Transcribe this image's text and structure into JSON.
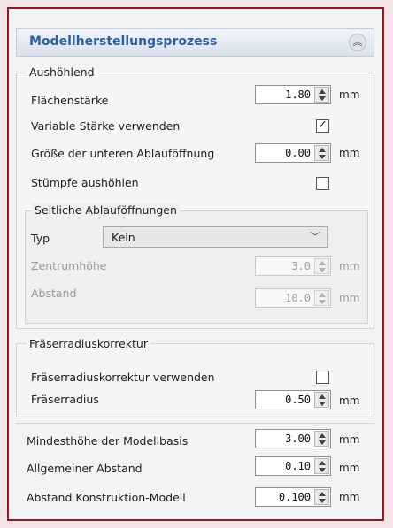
{
  "panel": {
    "title": "Modellherstellungsprozess",
    "collapse_icon": "double-chevron-up-icon"
  },
  "hollowing": {
    "group_title": "Aushöhlend",
    "wall_thickness": {
      "label": "Flächenstärke",
      "value": "1.80",
      "unit": "mm"
    },
    "variable_thickness": {
      "label": "Variable Stärke verwenden",
      "checked": true,
      "check_glyph": "✓"
    },
    "bottom_drain": {
      "label": "Größe der unteren Ablauföffnung",
      "value": "0.00",
      "unit": "mm"
    },
    "hollow_stumps": {
      "label": "Stümpfe aushöhlen",
      "checked": false
    },
    "side_drains": {
      "group_title": "Seitliche Ablauföffnungen",
      "type": {
        "label": "Typ",
        "value": "Kein",
        "chevron_icon": "chevron-down-icon"
      },
      "center_height": {
        "label": "Zentrumhöhe",
        "value": "3.0",
        "unit": "mm"
      },
      "distance": {
        "label": "Abstand",
        "value": "10.0",
        "unit": "mm"
      }
    }
  },
  "tool_radius": {
    "group_title": "Fräserradiuskorrektur",
    "use": {
      "label": "Fräserradiuskorrektur verwenden",
      "checked": false
    },
    "radius": {
      "label": "Fräserradius",
      "value": "0.50",
      "unit": "mm"
    }
  },
  "model_base": {
    "min_height": {
      "label": "Mindesthöhe der Modellbasis",
      "value": "3.00",
      "unit": "mm"
    },
    "general_gap": {
      "label": "Allgemeiner Abstand",
      "value": "0.10",
      "unit": "mm"
    },
    "construction_gap": {
      "label": "Abstand Konstruktion-Modell",
      "value": "0.100",
      "unit": "mm"
    }
  },
  "colors": {
    "frame": "#8a1c2a",
    "title": "#2a5fa7",
    "background": "#f3f3f5"
  }
}
